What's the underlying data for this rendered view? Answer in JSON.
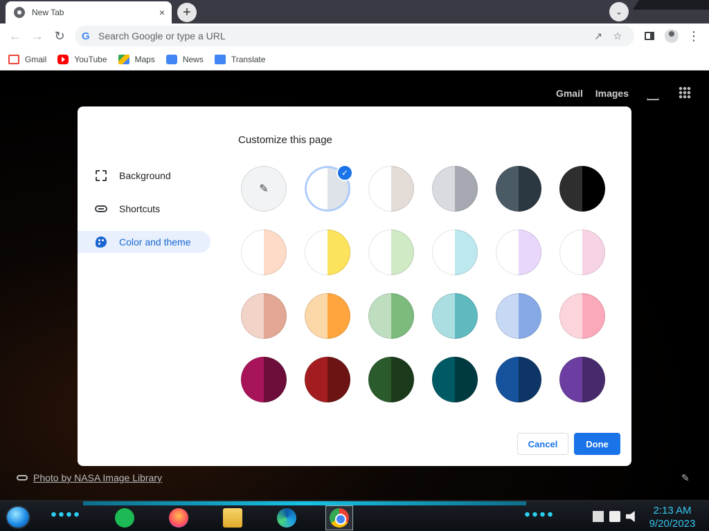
{
  "browser": {
    "tab_title": "New Tab",
    "tab_close": "×",
    "new_tab": "+",
    "tab_search": "⌄",
    "omnibox_placeholder": "Search Google or type a URL"
  },
  "bookmarks": [
    {
      "label": "Gmail",
      "icon": "gmail-icon"
    },
    {
      "label": "YouTube",
      "icon": "youtube-icon"
    },
    {
      "label": "Maps",
      "icon": "maps-icon"
    },
    {
      "label": "News",
      "icon": "news-icon"
    },
    {
      "label": "Translate",
      "icon": "translate-icon"
    }
  ],
  "ntp": {
    "gmail": "Gmail",
    "images": "Images",
    "photo_credit": "Photo by NASA Image Library"
  },
  "dialog": {
    "title": "Customize this page",
    "menu": [
      {
        "label": "Background",
        "icon": "image-icon",
        "active": false
      },
      {
        "label": "Shortcuts",
        "icon": "link-icon",
        "active": false
      },
      {
        "label": "Color and theme",
        "icon": "palette-icon",
        "active": true
      }
    ],
    "cancel": "Cancel",
    "done": "Done",
    "selected_index": 1,
    "swatches": [
      {
        "left": "#f1f3f4",
        "right": "#f1f3f4",
        "kind": "custom"
      },
      {
        "left": "#ffffff",
        "right": "#dee3ea"
      },
      {
        "left": "#ffffff",
        "right": "#e4dcd7"
      },
      {
        "left": "#d9dbe0",
        "right": "#a6a9b1"
      },
      {
        "left": "#4b5b66",
        "right": "#2b3741"
      },
      {
        "left": "#2e2e2e",
        "right": "#000000"
      },
      {
        "left": "#ffffff",
        "right": "#fddbc8"
      },
      {
        "left": "#ffffff",
        "right": "#fde25b"
      },
      {
        "left": "#ffffff",
        "right": "#cfeac5"
      },
      {
        "left": "#ffffff",
        "right": "#bde8ef"
      },
      {
        "left": "#ffffff",
        "right": "#e8d7fb"
      },
      {
        "left": "#ffffff",
        "right": "#f7d4e5"
      },
      {
        "left": "#f2d3c7",
        "right": "#e2a895"
      },
      {
        "left": "#fcd7a7",
        "right": "#ffa53e"
      },
      {
        "left": "#bfdec0",
        "right": "#7cba7e"
      },
      {
        "left": "#aadee0",
        "right": "#5fbac0"
      },
      {
        "left": "#c7d8f4",
        "right": "#86a9e6"
      },
      {
        "left": "#fcd4dc",
        "right": "#faa9ba"
      },
      {
        "left": "#a8145a",
        "right": "#6d0e3a"
      },
      {
        "left": "#a31d20",
        "right": "#6c1313"
      },
      {
        "left": "#2b5b2c",
        "right": "#1a3a1b"
      },
      {
        "left": "#005a63",
        "right": "#003a40"
      },
      {
        "left": "#17529d",
        "right": "#0d3666"
      },
      {
        "left": "#6c3ea1",
        "right": "#472a6c"
      }
    ]
  },
  "taskbar": {
    "time": "2:13 AM",
    "date": "9/20/2023"
  }
}
